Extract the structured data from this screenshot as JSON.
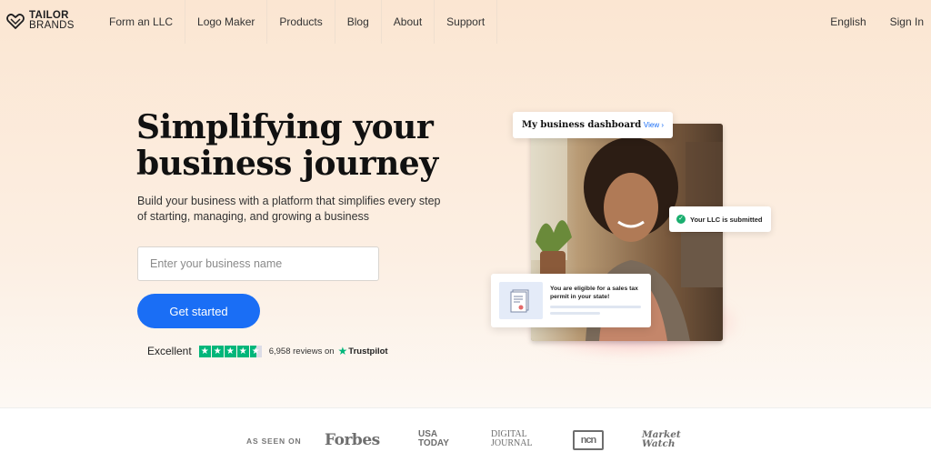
{
  "brand": {
    "line1": "TAILOR",
    "line2": "BRANDS",
    "accent_color": "#1a6ef5"
  },
  "nav": {
    "links": [
      "Form an LLC",
      "Logo Maker",
      "Products",
      "Blog",
      "About",
      "Support"
    ],
    "language": "English",
    "sign_in": "Sign In"
  },
  "hero": {
    "title_line1": "Simplifying your",
    "title_line2": "business journey",
    "subtitle": "Build your business with a platform that simplifies every step of starting, managing, and growing a business",
    "input_placeholder": "Enter your business name",
    "cta_label": "Get started"
  },
  "trustpilot": {
    "rating_word": "Excellent",
    "stars": 4.5,
    "reviews_text": "6,958 reviews on",
    "brand": "Trustpilot",
    "star_color": "#00b67a"
  },
  "dashboard_card": {
    "title": "My business dashboard",
    "view_label": "View ›"
  },
  "llc_card": {
    "text": "Your LLC is submitted",
    "status_color": "#1aae6f"
  },
  "tax_card": {
    "text": "You are eligible for a sales tax permit in your state!"
  },
  "press": {
    "label": "AS SEEN ON",
    "logos": {
      "forbes": "Forbes",
      "usa_today_1": "USA",
      "usa_today_2": "TODAY",
      "digital_journal_1": "DIGITAL",
      "digital_journal_2": "JOURNAL",
      "ncn": "ncn",
      "marketwatch_1": "Market",
      "marketwatch_2": "Watch"
    }
  }
}
